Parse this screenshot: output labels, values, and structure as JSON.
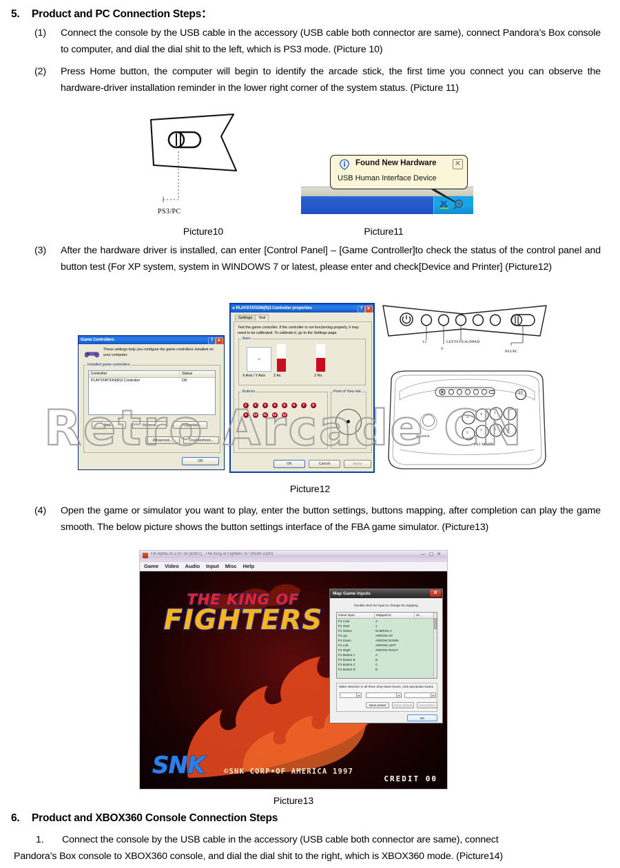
{
  "section5": {
    "number": "5.",
    "title": "Product and PC Connection Steps：",
    "items": [
      {
        "marker": "(1)",
        "text": "Connect the console by the USB cable in the accessory (USB cable both connector are same), connect Pandora’s Box console to computer, and dial the dial shit to the left, which is PS3 mode. (Picture 10)"
      },
      {
        "marker": "(2)",
        "text": "Press Home button, the computer will begin to identify the arcade stick, the first time you connect you can observe the hardware-driver installation reminder in the lower right corner of the system status. (Picture 11)"
      },
      {
        "marker": "(3)",
        "text": "After the hardware driver is installed, can enter [Control Panel] – [Game Controller]to check the status of the control panel and button test (For XP system, system in WINDOWS 7 or latest, please enter and check[Device and Printer] (Picture12)"
      },
      {
        "marker": "(4)",
        "text": "Open the game or simulator you want to play, enter the button settings, buttons mapping, after completion can play the game smooth. The below picture shows the button settings interface of the FBA game simulator. (Picture13)"
      }
    ]
  },
  "section6": {
    "number": "6.",
    "title": "Product and XBOX360 Console Connection Steps",
    "items": [
      {
        "marker": "1.",
        "text": "Connect the console by the USB cable in the accessory (USB cable both connector are same),     connect"
      },
      {
        "marker": "",
        "text": "Pandora’s Box console to XBOX360 console, and dial the dial shit to the right, which is XBOX360 mode. (Picture14)"
      }
    ]
  },
  "captions": {
    "picture10": "Picture10",
    "picture11": "Picture11",
    "picture12": "Picture12",
    "picture13": "Picture13"
  },
  "picture10": {
    "dial_label": "PS3/PC"
  },
  "picture11": {
    "balloon_title": "Found New Hardware",
    "balloon_body": "USB Human Interface Device",
    "close_glyph": "✕",
    "info_icon": "info-icon",
    "tray_icons": [
      "network-icon",
      "usb-icon"
    ]
  },
  "game_controllers_dialog": {
    "title": "Game Controllers",
    "help_glyph": "?",
    "close_glyph": "✕",
    "intro": "These settings help you configure the game controllers installed on your computer.",
    "group_label": "Installed game controllers",
    "columns": [
      "Controller",
      "Status"
    ],
    "rows": [
      {
        "controller": "PLAYSTATION(R)3 Controller",
        "status": "OK"
      }
    ],
    "buttons": [
      "Add...",
      "Remove",
      "Properties"
    ],
    "buttons2": [
      "Advanced...",
      "Troubleshoot..."
    ],
    "ok": "OK"
  },
  "controller_properties_dialog": {
    "title": "PLAYSTATION(R)3 Controller properties",
    "help_glyph": "?",
    "close_glyph": "✕",
    "tabs": [
      "Settings",
      "Test"
    ],
    "active_tab": "Test",
    "instruction": "Test the game controller.  If the controller is not functioning properly, it may need to be calibrated.  To calibrate it, go to the Settings page.",
    "axes_label": "Axes",
    "axes_captions": [
      "X Axis / Y Axis",
      "Z Ax.",
      "Z Ro."
    ],
    "crosshair": "+",
    "buttons_label": "Buttons",
    "button_numbers": [
      "1",
      "2",
      "3",
      "4",
      "5",
      "6",
      "7",
      "8",
      "9",
      "10",
      "11",
      "12",
      "13"
    ],
    "pov_label": "Point of View Hat",
    "footer_buttons": [
      "OK",
      "Cancel",
      "Apply"
    ]
  },
  "arcade_top_panel": {
    "power_icon": "power-icon",
    "labels": [
      "13",
      "LEFTSTICK/DPAD",
      "9",
      "PS3/PC"
    ]
  },
  "arcade_stick": {
    "callout": "10",
    "joystick_label": "Joystick",
    "mode_label": "PS3 MODE",
    "button_numbers": [
      "1",
      "2",
      "3",
      "4",
      "5",
      "6",
      "7",
      "8"
    ]
  },
  "watermark": {
    "text": "Retro Arcade CN"
  },
  "fba": {
    "window_title": "FB Alpha v0.2.97.30 [kof97] - The King of Fighters '97 (NGM-2320)",
    "minimize_glyph": "—",
    "maximize_glyph": "▢",
    "close_glyph": "✕",
    "menus": [
      "Game",
      "Video",
      "Audio",
      "Input",
      "Misc",
      "Help"
    ],
    "screen": {
      "title_line1": "THE KING OF",
      "title_line2": "FIGHTERS",
      "logo": "SNK",
      "copyright": "©SNK  CORP•OF  AMERICA  1997",
      "credit": "CREDIT   00"
    },
    "map_game_inputs": {
      "title": "Map Game Inputs",
      "close_glyph": "✕",
      "hint": "Double-click an input to change its mapping",
      "columns": [
        "Game input",
        "Mapped to",
        "St..."
      ],
      "rows": [
        {
          "input": "P1 Coin",
          "mapped": "3"
        },
        {
          "input": "P1 Start",
          "mapped": "1"
        },
        {
          "input": "P1 Select",
          "mapped": "NUMPAD 2"
        },
        {
          "input": "P1 Up",
          "mapped": "ARROW UP"
        },
        {
          "input": "P1 Down",
          "mapped": "ARROW DOWN"
        },
        {
          "input": "P1 Left",
          "mapped": "ARROW LEFT"
        },
        {
          "input": "P1 Right",
          "mapped": "ARROW RIGHT"
        },
        {
          "input": "P1 Button A",
          "mapped": "A"
        },
        {
          "input": "P1 Button B",
          "mapped": "B"
        },
        {
          "input": "P1 Button C",
          "mapped": "C"
        },
        {
          "input": "P1 Button D",
          "mapped": "D"
        }
      ],
      "note": "Make selection in all three drop-down boxes, click apropriate button",
      "preset_buttons": [
        "Save preset",
        "Make default",
        "Use preset"
      ],
      "ok": "OK"
    }
  }
}
